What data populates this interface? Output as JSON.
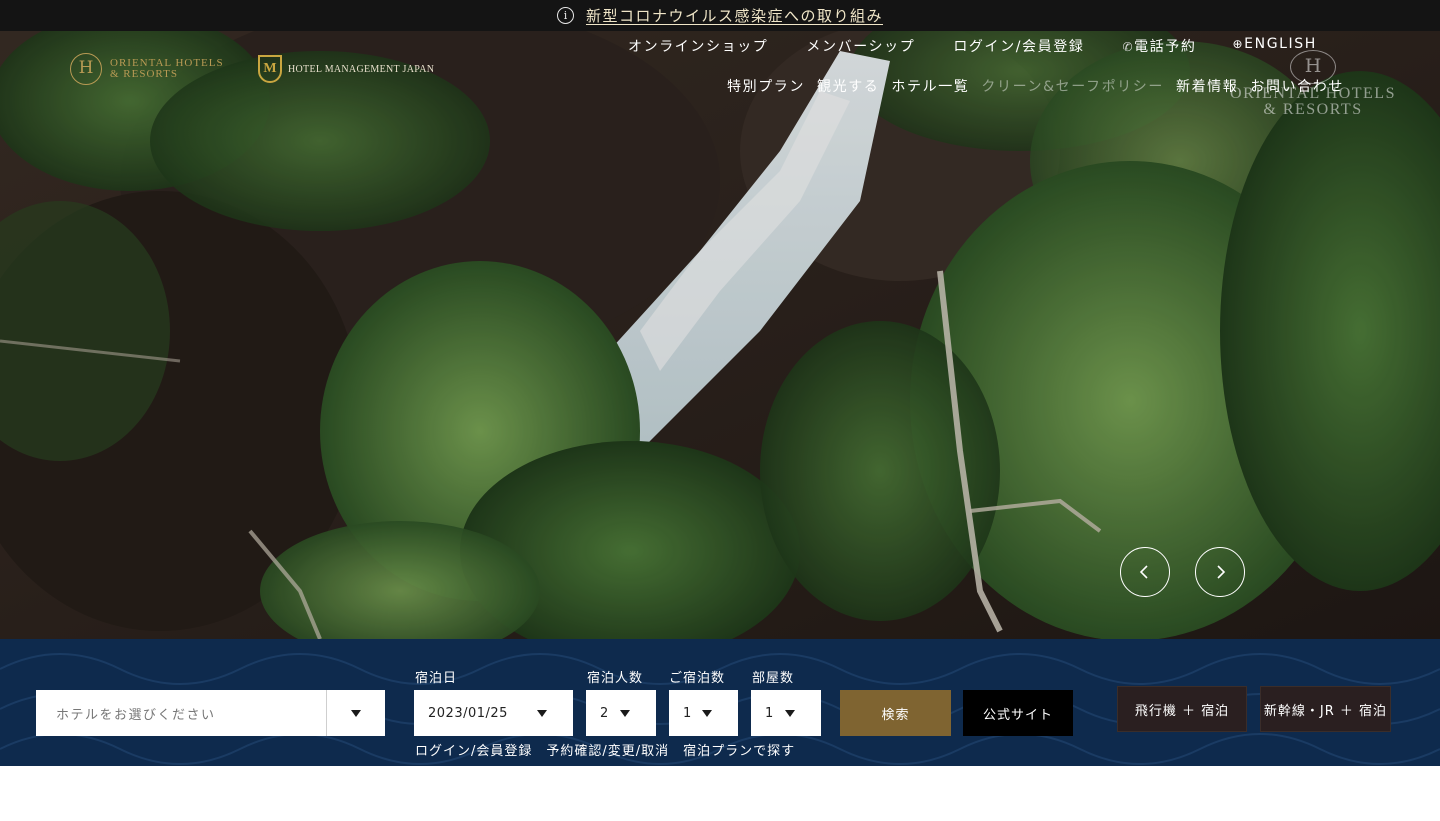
{
  "notice": {
    "icon": "info-icon",
    "text": "新型コロナウイルス感染症への取り組み"
  },
  "header": {
    "logos": {
      "oriental_mark": "H",
      "oriental_text_line1": "ORIENTAL HOTELS",
      "oriental_text_line2": "& RESORTS",
      "hmj_mark": "M",
      "hmj_text": "HOTEL MANAGEMENT JAPAN"
    },
    "top_nav": {
      "online_shop": "オンラインショップ",
      "membership": "メンバーシップ",
      "login": "ログイン/会員登録",
      "phone": "電話予約",
      "english": "ENGLISH"
    },
    "main_nav": {
      "special_plan": "特別プラン",
      "sightseeing": "観光する",
      "hotel_list": "ホテル一覧",
      "clean_safe": "クリーン&セーフポリシー",
      "news": "新着情報",
      "contact": "お問い合わせ"
    },
    "brand_right": {
      "mark": "H",
      "line1": "ORIENTAL HOTELS",
      "line2": "& RESORTS"
    }
  },
  "hero": {
    "prev_icon": "chevron-left-icon",
    "next_icon": "chevron-right-icon"
  },
  "booking": {
    "hotel_placeholder": "ホテルをお選びください",
    "date_label": "宿泊日",
    "date_value": "2023/01/25",
    "guests_label": "宿泊人数",
    "guests_value": "2",
    "nights_label": "ご宿泊数",
    "nights_value": "1",
    "rooms_label": "部屋数",
    "rooms_value": "1",
    "search_label": "検索",
    "official_label": "公式サイト",
    "air_label": "飛行機 ＋ 宿泊",
    "rail_label": "新幹線・JR ＋ 宿泊",
    "links": {
      "login": "ログイン/会員登録",
      "reservation": "予約確認/変更/取消",
      "plan_search": "宿泊プランで探す"
    }
  },
  "colors": {
    "notice_bg": "#141414",
    "booking_bg": "#0e2a4d",
    "search_btn": "#7f6431",
    "official_btn": "#000000",
    "combo_btn": "#2a1f20",
    "gold": "#b89a54"
  }
}
